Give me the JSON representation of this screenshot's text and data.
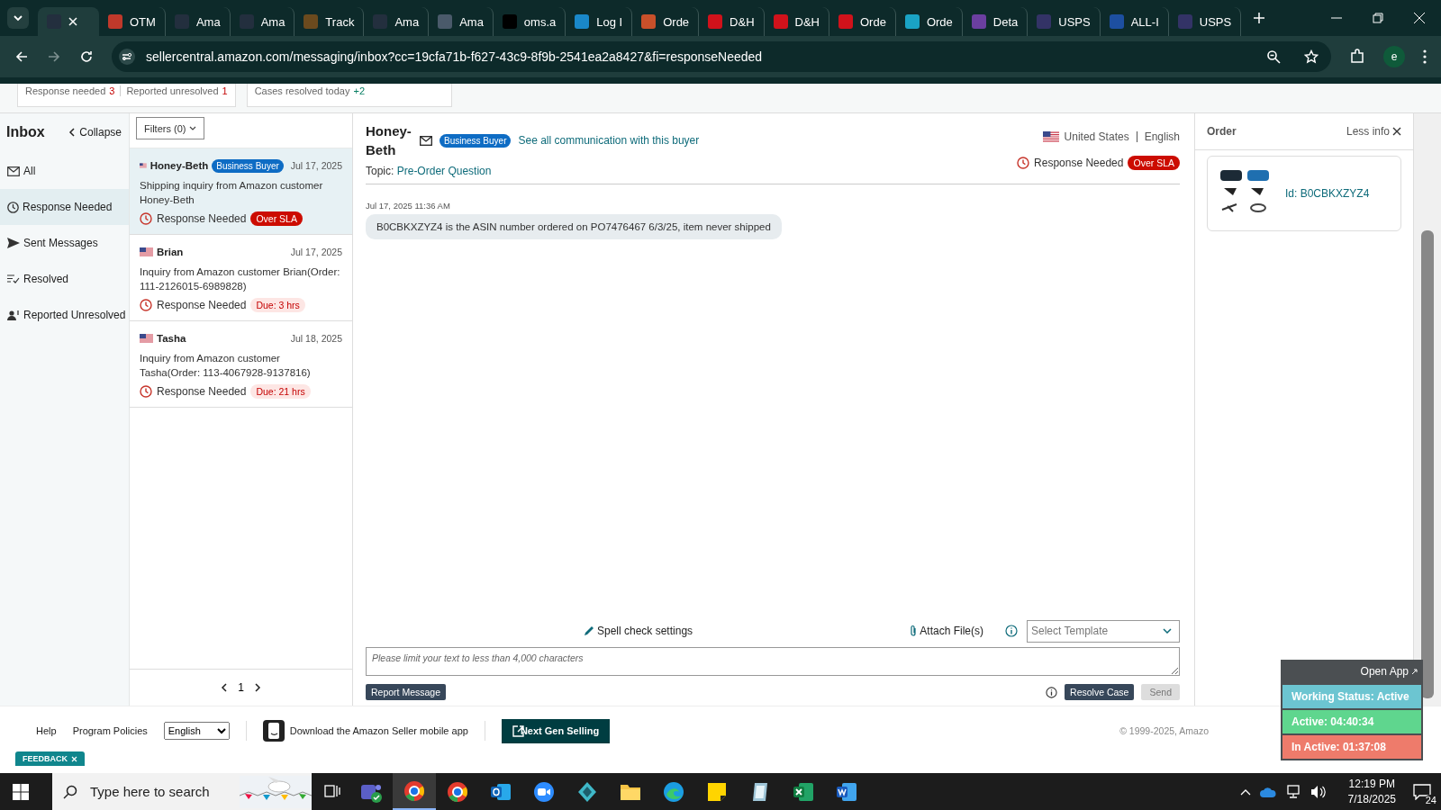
{
  "browser": {
    "tabs": [
      {
        "selected": true,
        "color": "#232f3e"
      },
      {
        "title": "OTM",
        "selected": false,
        "color": "#c0392b"
      },
      {
        "title": "Ama",
        "selected": false,
        "color": "#232f3e"
      },
      {
        "title": "Ama",
        "selected": false,
        "color": "#232f3e"
      },
      {
        "title": "Track",
        "selected": false,
        "color": "#6b4a1e"
      },
      {
        "title": "Ama",
        "selected": false,
        "color": "#232f3e"
      },
      {
        "title": "Ama",
        "selected": false,
        "color": "#4a5a6a"
      },
      {
        "title": "oms.a",
        "selected": false,
        "color": "#000000"
      },
      {
        "title": "Log I",
        "selected": false,
        "color": "#1a88c9"
      },
      {
        "title": "Orde",
        "selected": false,
        "color": "#c8502a"
      },
      {
        "title": "D&H",
        "selected": false,
        "color": "#d0121b"
      },
      {
        "title": "D&H",
        "selected": false,
        "color": "#d0121b"
      },
      {
        "title": "Orde",
        "selected": false,
        "color": "#d0121b"
      },
      {
        "title": "Orde",
        "selected": false,
        "color": "#1aa3c4"
      },
      {
        "title": "Deta",
        "selected": false,
        "color": "#6b3fa0"
      },
      {
        "title": "USPS",
        "selected": false,
        "color": "#333366"
      },
      {
        "title": "ALL-I",
        "selected": false,
        "color": "#1d4fa0"
      },
      {
        "title": "USPS",
        "selected": false,
        "color": "#333366"
      }
    ],
    "url": "sellercentral.amazon.com/messaging/inbox?cc=19cfa71b-f627-43c9-8f9b-2541ea2a8427&fi=responseNeeded",
    "profile": "e"
  },
  "stats": [
    {
      "items": [
        {
          "label": "Response needed",
          "count": "3"
        },
        {
          "label": "Reported unresolved",
          "count": "1"
        }
      ]
    },
    {
      "items": [
        {
          "label": "Cases resolved today",
          "count": "+2"
        }
      ]
    }
  ],
  "sidebar": {
    "title": "Inbox",
    "collapse": "Collapse",
    "items": [
      {
        "label": "All",
        "kind": "mail",
        "selected": false
      },
      {
        "label": "Response Needed",
        "kind": "clock",
        "selected": true
      },
      {
        "label": "Sent Messages",
        "kind": "send",
        "selected": false
      },
      {
        "label": "Resolved",
        "kind": "resolved",
        "selected": false
      },
      {
        "label": "Reported Unresolved",
        "kind": "report",
        "selected": false
      }
    ]
  },
  "list": {
    "filters": "Filters (0)",
    "conversations": [
      {
        "name": "Honey-Beth",
        "badge": "Business Buyer",
        "date": "Jul 17, 2025",
        "subject": "Shipping inquiry from Amazon customer Honey-Beth",
        "status": "Response Needed",
        "sla": "Over SLA",
        "overdue": true,
        "selected": true
      },
      {
        "name": "Brian",
        "date": "Jul 17, 2025",
        "subject": "Inquiry from Amazon customer Brian(Order: 111-2126015-6989828)",
        "status": "Response Needed",
        "sla": "Due: 3 hrs",
        "overdue": false,
        "selected": false
      },
      {
        "name": "Tasha",
        "date": "Jul 18, 2025",
        "subject": "Inquiry from Amazon customer Tasha(Order: 113-4067928-9137816)",
        "status": "Response Needed",
        "sla": "Due: 21 hrs",
        "overdue": false,
        "selected": false
      }
    ],
    "page": "1"
  },
  "conversation": {
    "buyer": "Honey-Beth",
    "badge": "Business Buyer",
    "see_all": "See all communication with this buyer",
    "country": "United States",
    "language": "English",
    "topic_label": "Topic:",
    "topic": "Pre-Order Question",
    "status": "Response Needed",
    "sla": "Over SLA",
    "messages": [
      {
        "time": "Jul 17, 2025 11:36 AM",
        "text": "B0CBKXZYZ4 is the ASIN number ordered on PO7476467 6/3/25, item never shipped"
      }
    ],
    "spell_check": "Spell check settings",
    "attach": "Attach File(s)",
    "template_placeholder": "Select Template",
    "reply_placeholder": "Please limit your text to less than 4,000 characters",
    "report": "Report Message",
    "resolve": "Resolve Case",
    "send": {
      "label": "Send",
      "disabled": true
    }
  },
  "order": {
    "title": "Order",
    "less_info": "Less info",
    "item_id": "Id: B0CBKXZYZ4"
  },
  "footer": {
    "links": [
      "Help",
      "Program Policies"
    ],
    "language": "English",
    "app_link": "Download the Amazon Seller mobile app",
    "next_gen": "Next Gen Selling",
    "copyright": "© 1999-2025, Amazo",
    "feedback": "FEEDBACK"
  },
  "widget": {
    "open_app": "Open App",
    "rows": [
      {
        "label": "Working Status: Active",
        "color": "#6cc5d1"
      },
      {
        "label": "Active: 04:40:34",
        "color": "#5fd68e"
      },
      {
        "label": "In Active: 01:37:08",
        "color": "#ee7b6b"
      }
    ]
  },
  "taskbar": {
    "search_placeholder": "Type here to search",
    "time": "12:19 PM",
    "date": "7/18/2025",
    "notifications": "24"
  }
}
